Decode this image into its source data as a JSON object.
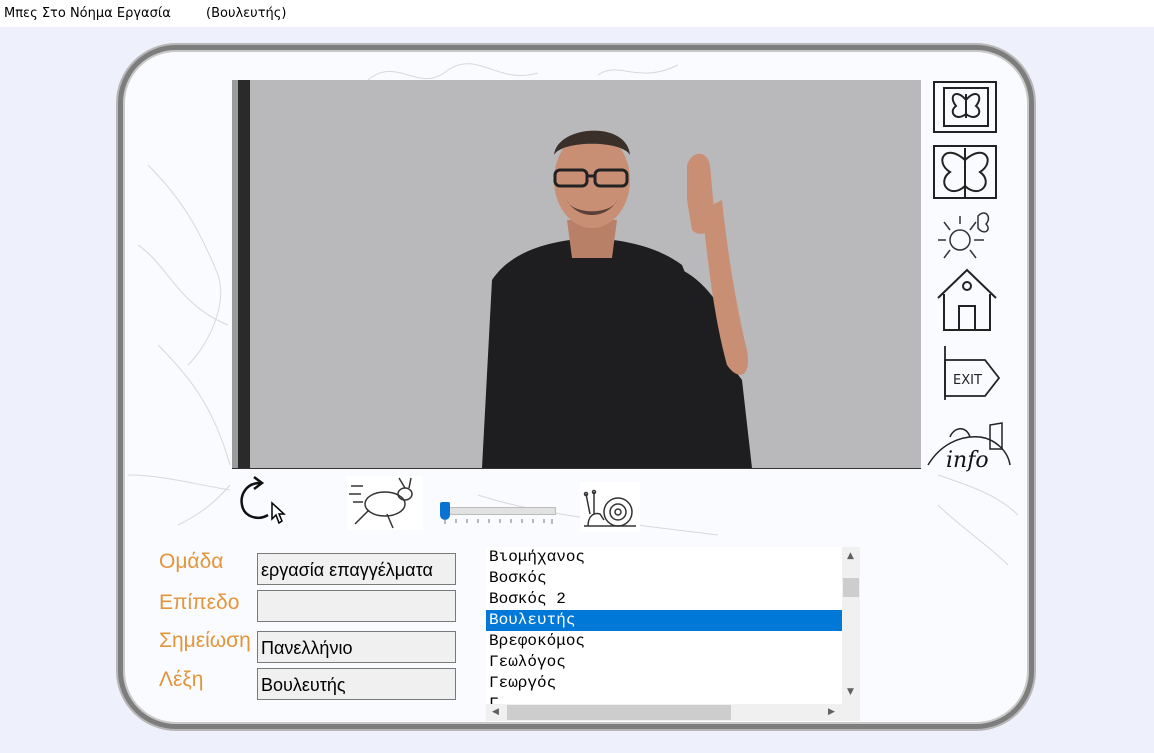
{
  "window": {
    "title": "Μπες Στο Νόημα Εργασία",
    "subtitle": "(Βουλευτής)"
  },
  "sidebar": {
    "icons": [
      "butterfly-small-icon",
      "butterfly-large-icon",
      "sun-butterfly-icon",
      "home-icon",
      "exit-icon",
      "info-icon"
    ]
  },
  "controls": {
    "speed_slider_value": 0,
    "icons": [
      "replay-icon",
      "rabbit-fast-icon",
      "snail-slow-icon"
    ]
  },
  "form": {
    "group_label": "Ομάδα",
    "group_value": "εργασία επαγγέλματα",
    "level_label": "Επίπεδο",
    "level_value": "",
    "notes_label": "Σημείωση",
    "notes_value": "Πανελλήνιο",
    "word_label": "Λέξη",
    "word_value": "Βουλευτής"
  },
  "word_list": {
    "items": [
      "Βιομήχανος",
      "Βοσκός",
      "Βοσκός 2",
      "Βουλευτής",
      "Βρεφοκόμος",
      "Γεωλόγος",
      "Γεωργός",
      "Γ..."
    ],
    "selected_index": 3
  },
  "colors": {
    "label_color": "#e2953b",
    "selection": "#0078d7",
    "slider_thumb": "#0a72d1"
  }
}
